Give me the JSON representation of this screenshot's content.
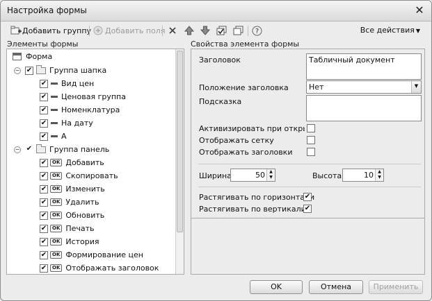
{
  "window": {
    "title": "Настройка формы"
  },
  "toolbar": {
    "add_group": "Добавить группу",
    "add_fields": "Добавить поля",
    "all_actions": "Все действия"
  },
  "left": {
    "section_title": "Элементы формы",
    "tree": [
      {
        "label": "Форма"
      },
      {
        "label": "Группа шапка"
      },
      {
        "label": "Вид цен"
      },
      {
        "label": "Ценовая группа"
      },
      {
        "label": "Номенклатура"
      },
      {
        "label": "На дату"
      },
      {
        "label": "А"
      },
      {
        "label": "Группа панель"
      },
      {
        "label": "Добавить"
      },
      {
        "label": "Скопировать"
      },
      {
        "label": "Изменить"
      },
      {
        "label": "Удалить"
      },
      {
        "label": "Обновить"
      },
      {
        "label": "Печать"
      },
      {
        "label": "История"
      },
      {
        "label": "Формирование цен"
      },
      {
        "label": "Отображать заголовок"
      }
    ],
    "icons": {
      "ok": "OK",
      "check": "✔",
      "expanded": "−"
    }
  },
  "right": {
    "section_title": "Свойства элемента формы",
    "header_label": "Заголовок",
    "header_value": "Табличный документ",
    "title_position_label": "Положение заголовка",
    "title_position_value": "Нет",
    "hint_label": "Подсказка",
    "hint_value": "",
    "activate_label": "Активизировать при открытии",
    "grid_label": "Отображать сетку",
    "headers_label": "Отображать заголовки",
    "width_label": "Ширина",
    "width_value": "50",
    "height_label": "Высота",
    "height_value": "10",
    "stretch_h_label": "Растягивать по горизонтали",
    "stretch_v_label": "Растягивать по вертикали",
    "checks": {
      "activate": "",
      "grid": "",
      "headers": "",
      "stretch_h": "✔",
      "stretch_v": "✔"
    }
  },
  "footer": {
    "ok": "OK",
    "cancel": "Отмена",
    "apply": "Применить"
  }
}
